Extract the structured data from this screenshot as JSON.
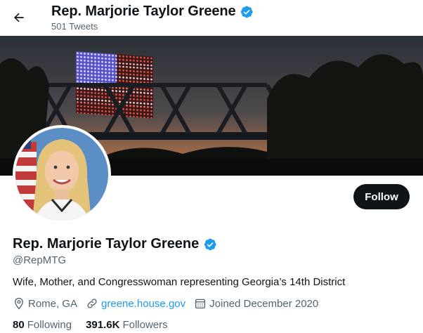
{
  "header": {
    "title": "Rep. Marjorie Taylor Greene",
    "tweet_count": "501 Tweets"
  },
  "profile": {
    "name": "Rep. Marjorie Taylor Greene",
    "handle": "@RepMTG",
    "bio": "Wife, Mother, and Congresswoman representing Georgia’s 14th District",
    "location": "Rome, GA",
    "website": "greene.house.gov",
    "joined": "Joined December 2020",
    "following_count": "80",
    "following_label": "Following",
    "followers_count": "391.6K",
    "followers_label": "Followers",
    "follow_button": "Follow"
  },
  "colors": {
    "accent": "#1d9bf0",
    "text_primary": "#0f1419",
    "text_secondary": "#536471",
    "button_bg": "#0f1419"
  }
}
